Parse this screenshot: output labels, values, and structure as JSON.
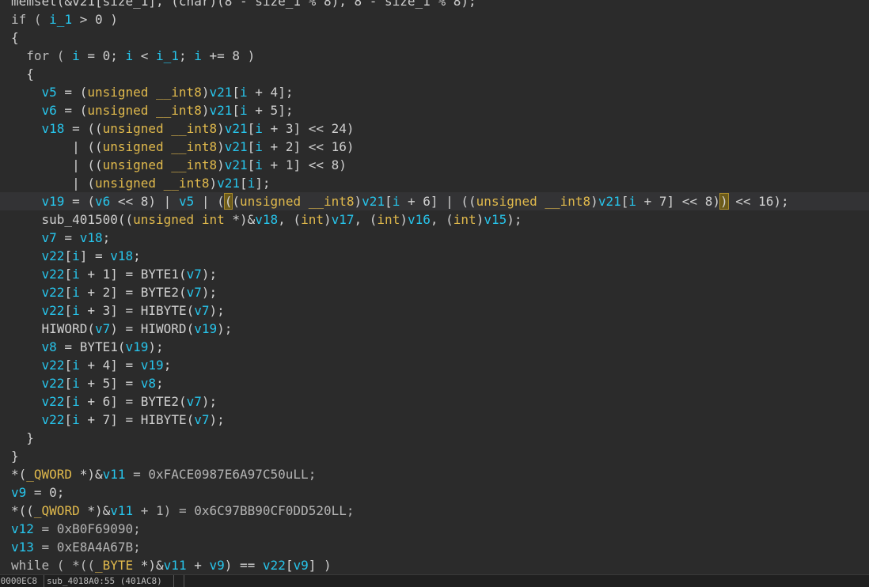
{
  "editor": {
    "lines": [
      {
        "tokens": [
          {
            "t": "memset(&v21[size_1], (char)(8 - size_1 % 8), 8 - size_1 % 8);",
            "c": "plain"
          }
        ]
      },
      {
        "tokens": [
          {
            "t": "if ( ",
            "c": "kw"
          },
          {
            "t": "i_1",
            "c": "var"
          },
          {
            "t": " > 0 )",
            "c": "plain"
          }
        ]
      },
      {
        "tokens": [
          {
            "t": "{",
            "c": "plain"
          }
        ]
      },
      {
        "tokens": [
          {
            "t": "  for ( ",
            "c": "kw"
          },
          {
            "t": "i",
            "c": "var"
          },
          {
            "t": " = 0; ",
            "c": "plain"
          },
          {
            "t": "i",
            "c": "var"
          },
          {
            "t": " < ",
            "c": "plain"
          },
          {
            "t": "i_1",
            "c": "var"
          },
          {
            "t": "; ",
            "c": "plain"
          },
          {
            "t": "i",
            "c": "var"
          },
          {
            "t": " += 8 )",
            "c": "plain"
          }
        ]
      },
      {
        "tokens": [
          {
            "t": "  {",
            "c": "plain"
          }
        ]
      },
      {
        "tokens": [
          {
            "t": "    ",
            "c": "plain"
          },
          {
            "t": "v5",
            "c": "var"
          },
          {
            "t": " = (",
            "c": "plain"
          },
          {
            "t": "unsigned __int8",
            "c": "type"
          },
          {
            "t": ")",
            "c": "plain"
          },
          {
            "t": "v21",
            "c": "var"
          },
          {
            "t": "[",
            "c": "plain"
          },
          {
            "t": "i",
            "c": "var"
          },
          {
            "t": " + 4];",
            "c": "plain"
          }
        ]
      },
      {
        "tokens": [
          {
            "t": "    ",
            "c": "plain"
          },
          {
            "t": "v6",
            "c": "var"
          },
          {
            "t": " = (",
            "c": "plain"
          },
          {
            "t": "unsigned __int8",
            "c": "type"
          },
          {
            "t": ")",
            "c": "plain"
          },
          {
            "t": "v21",
            "c": "var"
          },
          {
            "t": "[",
            "c": "plain"
          },
          {
            "t": "i",
            "c": "var"
          },
          {
            "t": " + 5];",
            "c": "plain"
          }
        ]
      },
      {
        "tokens": [
          {
            "t": "    ",
            "c": "plain"
          },
          {
            "t": "v18",
            "c": "var"
          },
          {
            "t": " = ((",
            "c": "plain"
          },
          {
            "t": "unsigned __int8",
            "c": "type"
          },
          {
            "t": ")",
            "c": "plain"
          },
          {
            "t": "v21",
            "c": "var"
          },
          {
            "t": "[",
            "c": "plain"
          },
          {
            "t": "i",
            "c": "var"
          },
          {
            "t": " + 3] << 24)",
            "c": "plain"
          }
        ]
      },
      {
        "tokens": [
          {
            "t": "        | ((",
            "c": "plain"
          },
          {
            "t": "unsigned __int8",
            "c": "type"
          },
          {
            "t": ")",
            "c": "plain"
          },
          {
            "t": "v21",
            "c": "var"
          },
          {
            "t": "[",
            "c": "plain"
          },
          {
            "t": "i",
            "c": "var"
          },
          {
            "t": " + 2] << 16)",
            "c": "plain"
          }
        ]
      },
      {
        "tokens": [
          {
            "t": "        | ((",
            "c": "plain"
          },
          {
            "t": "unsigned __int8",
            "c": "type"
          },
          {
            "t": ")",
            "c": "plain"
          },
          {
            "t": "v21",
            "c": "var"
          },
          {
            "t": "[",
            "c": "plain"
          },
          {
            "t": "i",
            "c": "var"
          },
          {
            "t": " + 1] << 8)",
            "c": "plain"
          }
        ]
      },
      {
        "tokens": [
          {
            "t": "        | (",
            "c": "plain"
          },
          {
            "t": "unsigned __int8",
            "c": "type"
          },
          {
            "t": ")",
            "c": "plain"
          },
          {
            "t": "v21",
            "c": "var"
          },
          {
            "t": "[",
            "c": "plain"
          },
          {
            "t": "i",
            "c": "var"
          },
          {
            "t": "];",
            "c": "plain"
          }
        ]
      },
      {
        "current": true,
        "tokens": [
          {
            "t": "    ",
            "c": "plain"
          },
          {
            "t": "v19",
            "c": "var"
          },
          {
            "t": " = (",
            "c": "plain"
          },
          {
            "t": "v6",
            "c": "var"
          },
          {
            "t": " << 8) | ",
            "c": "plain"
          },
          {
            "t": "v5",
            "c": "var"
          },
          {
            "t": " | (",
            "c": "plain"
          },
          {
            "t": "(",
            "c": "paren"
          },
          {
            "t": "(",
            "c": "plain"
          },
          {
            "t": "unsigned __int8",
            "c": "type"
          },
          {
            "t": ")",
            "c": "plain"
          },
          {
            "t": "v21",
            "c": "var"
          },
          {
            "t": "[",
            "c": "plain"
          },
          {
            "t": "i",
            "c": "var"
          },
          {
            "t": " + 6] | ((",
            "c": "plain"
          },
          {
            "t": "unsigned __int8",
            "c": "type"
          },
          {
            "t": ")",
            "c": "plain"
          },
          {
            "t": "v21",
            "c": "var"
          },
          {
            "t": "[",
            "c": "plain"
          },
          {
            "t": "i",
            "c": "var"
          },
          {
            "t": " + 7] << 8)",
            "c": "plain"
          },
          {
            "t": ")",
            "c": "paren"
          },
          {
            "t": " << 16);",
            "c": "plain"
          }
        ]
      },
      {
        "tokens": [
          {
            "t": "    sub_401500((",
            "c": "plain"
          },
          {
            "t": "unsigned int",
            "c": "type"
          },
          {
            "t": " *)&",
            "c": "plain"
          },
          {
            "t": "v18",
            "c": "var"
          },
          {
            "t": ", (",
            "c": "plain"
          },
          {
            "t": "int",
            "c": "type"
          },
          {
            "t": ")",
            "c": "plain"
          },
          {
            "t": "v17",
            "c": "var"
          },
          {
            "t": ", (",
            "c": "plain"
          },
          {
            "t": "int",
            "c": "type"
          },
          {
            "t": ")",
            "c": "plain"
          },
          {
            "t": "v16",
            "c": "var"
          },
          {
            "t": ", (",
            "c": "plain"
          },
          {
            "t": "int",
            "c": "type"
          },
          {
            "t": ")",
            "c": "plain"
          },
          {
            "t": "v15",
            "c": "var"
          },
          {
            "t": ");",
            "c": "plain"
          }
        ]
      },
      {
        "tokens": [
          {
            "t": "    ",
            "c": "plain"
          },
          {
            "t": "v7",
            "c": "var"
          },
          {
            "t": " = ",
            "c": "plain"
          },
          {
            "t": "v18",
            "c": "var"
          },
          {
            "t": ";",
            "c": "plain"
          }
        ]
      },
      {
        "tokens": [
          {
            "t": "    ",
            "c": "plain"
          },
          {
            "t": "v22",
            "c": "var"
          },
          {
            "t": "[",
            "c": "plain"
          },
          {
            "t": "i",
            "c": "var"
          },
          {
            "t": "] = ",
            "c": "plain"
          },
          {
            "t": "v18",
            "c": "var"
          },
          {
            "t": ";",
            "c": "plain"
          }
        ]
      },
      {
        "tokens": [
          {
            "t": "    ",
            "c": "plain"
          },
          {
            "t": "v22",
            "c": "var"
          },
          {
            "t": "[",
            "c": "plain"
          },
          {
            "t": "i",
            "c": "var"
          },
          {
            "t": " + 1] = BYTE1(",
            "c": "plain"
          },
          {
            "t": "v7",
            "c": "var"
          },
          {
            "t": ");",
            "c": "plain"
          }
        ]
      },
      {
        "tokens": [
          {
            "t": "    ",
            "c": "plain"
          },
          {
            "t": "v22",
            "c": "var"
          },
          {
            "t": "[",
            "c": "plain"
          },
          {
            "t": "i",
            "c": "var"
          },
          {
            "t": " + 2] = BYTE2(",
            "c": "plain"
          },
          {
            "t": "v7",
            "c": "var"
          },
          {
            "t": ");",
            "c": "plain"
          }
        ]
      },
      {
        "tokens": [
          {
            "t": "    ",
            "c": "plain"
          },
          {
            "t": "v22",
            "c": "var"
          },
          {
            "t": "[",
            "c": "plain"
          },
          {
            "t": "i",
            "c": "var"
          },
          {
            "t": " + 3] = HIBYTE(",
            "c": "plain"
          },
          {
            "t": "v7",
            "c": "var"
          },
          {
            "t": ");",
            "c": "plain"
          }
        ]
      },
      {
        "tokens": [
          {
            "t": "    HIWORD(",
            "c": "plain"
          },
          {
            "t": "v7",
            "c": "var"
          },
          {
            "t": ") = HIWORD(",
            "c": "plain"
          },
          {
            "t": "v19",
            "c": "var"
          },
          {
            "t": ");",
            "c": "plain"
          }
        ]
      },
      {
        "tokens": [
          {
            "t": "    ",
            "c": "plain"
          },
          {
            "t": "v8",
            "c": "var"
          },
          {
            "t": " = BYTE1(",
            "c": "plain"
          },
          {
            "t": "v19",
            "c": "var"
          },
          {
            "t": ");",
            "c": "plain"
          }
        ]
      },
      {
        "tokens": [
          {
            "t": "    ",
            "c": "plain"
          },
          {
            "t": "v22",
            "c": "var"
          },
          {
            "t": "[",
            "c": "plain"
          },
          {
            "t": "i",
            "c": "var"
          },
          {
            "t": " + 4] = ",
            "c": "plain"
          },
          {
            "t": "v19",
            "c": "var"
          },
          {
            "t": ";",
            "c": "plain"
          }
        ]
      },
      {
        "tokens": [
          {
            "t": "    ",
            "c": "plain"
          },
          {
            "t": "v22",
            "c": "var"
          },
          {
            "t": "[",
            "c": "plain"
          },
          {
            "t": "i",
            "c": "var"
          },
          {
            "t": " + 5] = ",
            "c": "plain"
          },
          {
            "t": "v8",
            "c": "var"
          },
          {
            "t": ";",
            "c": "plain"
          }
        ]
      },
      {
        "tokens": [
          {
            "t": "    ",
            "c": "plain"
          },
          {
            "t": "v22",
            "c": "var"
          },
          {
            "t": "[",
            "c": "plain"
          },
          {
            "t": "i",
            "c": "var"
          },
          {
            "t": " + 6] = BYTE2(",
            "c": "plain"
          },
          {
            "t": "v7",
            "c": "var"
          },
          {
            "t": ");",
            "c": "plain"
          }
        ]
      },
      {
        "tokens": [
          {
            "t": "    ",
            "c": "plain"
          },
          {
            "t": "v22",
            "c": "var"
          },
          {
            "t": "[",
            "c": "plain"
          },
          {
            "t": "i",
            "c": "var"
          },
          {
            "t": " + 7] = HIBYTE(",
            "c": "plain"
          },
          {
            "t": "v7",
            "c": "var"
          },
          {
            "t": ");",
            "c": "plain"
          }
        ]
      },
      {
        "tokens": [
          {
            "t": "  }",
            "c": "plain"
          }
        ]
      },
      {
        "tokens": [
          {
            "t": "}",
            "c": "plain"
          }
        ]
      },
      {
        "tokens": [
          {
            "t": "*(",
            "c": "plain"
          },
          {
            "t": "_QWORD",
            "c": "type"
          },
          {
            "t": " *)&",
            "c": "plain"
          },
          {
            "t": "v11",
            "c": "var"
          },
          {
            "t": " = 0xFACE0987E6A97C50uLL;",
            "c": "num"
          }
        ]
      },
      {
        "tokens": [
          {
            "t": "v9",
            "c": "var"
          },
          {
            "t": " = 0;",
            "c": "plain"
          }
        ]
      },
      {
        "tokens": [
          {
            "t": "*((",
            "c": "plain"
          },
          {
            "t": "_QWORD",
            "c": "type"
          },
          {
            "t": " *)&",
            "c": "plain"
          },
          {
            "t": "v11",
            "c": "var"
          },
          {
            "t": " + 1) = 0x6C97BB90CF0DD520LL;",
            "c": "num"
          }
        ]
      },
      {
        "tokens": [
          {
            "t": "v12",
            "c": "var"
          },
          {
            "t": " = 0xB0F69090;",
            "c": "num"
          }
        ]
      },
      {
        "tokens": [
          {
            "t": "v13",
            "c": "var"
          },
          {
            "t": " = 0xE8A4A67B;",
            "c": "num"
          }
        ]
      },
      {
        "tokens": [
          {
            "t": "while ( *((",
            "c": "kw"
          },
          {
            "t": "_BYTE",
            "c": "type"
          },
          {
            "t": " *)&",
            "c": "plain"
          },
          {
            "t": "v11",
            "c": "var"
          },
          {
            "t": " + ",
            "c": "plain"
          },
          {
            "t": "v9",
            "c": "var"
          },
          {
            "t": ") == ",
            "c": "plain"
          },
          {
            "t": "v22",
            "c": "var"
          },
          {
            "t": "[",
            "c": "plain"
          },
          {
            "t": "v9",
            "c": "var"
          },
          {
            "t": "] )",
            "c": "plain"
          }
        ]
      },
      {
        "tokens": [
          {
            "t": "{",
            "c": "plain"
          }
        ]
      }
    ]
  },
  "status_bar": {
    "offset": "00000EC8",
    "location": "sub_4018A0:55 (401AC8)",
    "extra": ""
  },
  "colors": {
    "background": "#2b2b2b",
    "variable": "#27c5ec",
    "type": "#e0b94c",
    "plain": "#d0d0d0",
    "current_line": "#333335"
  }
}
